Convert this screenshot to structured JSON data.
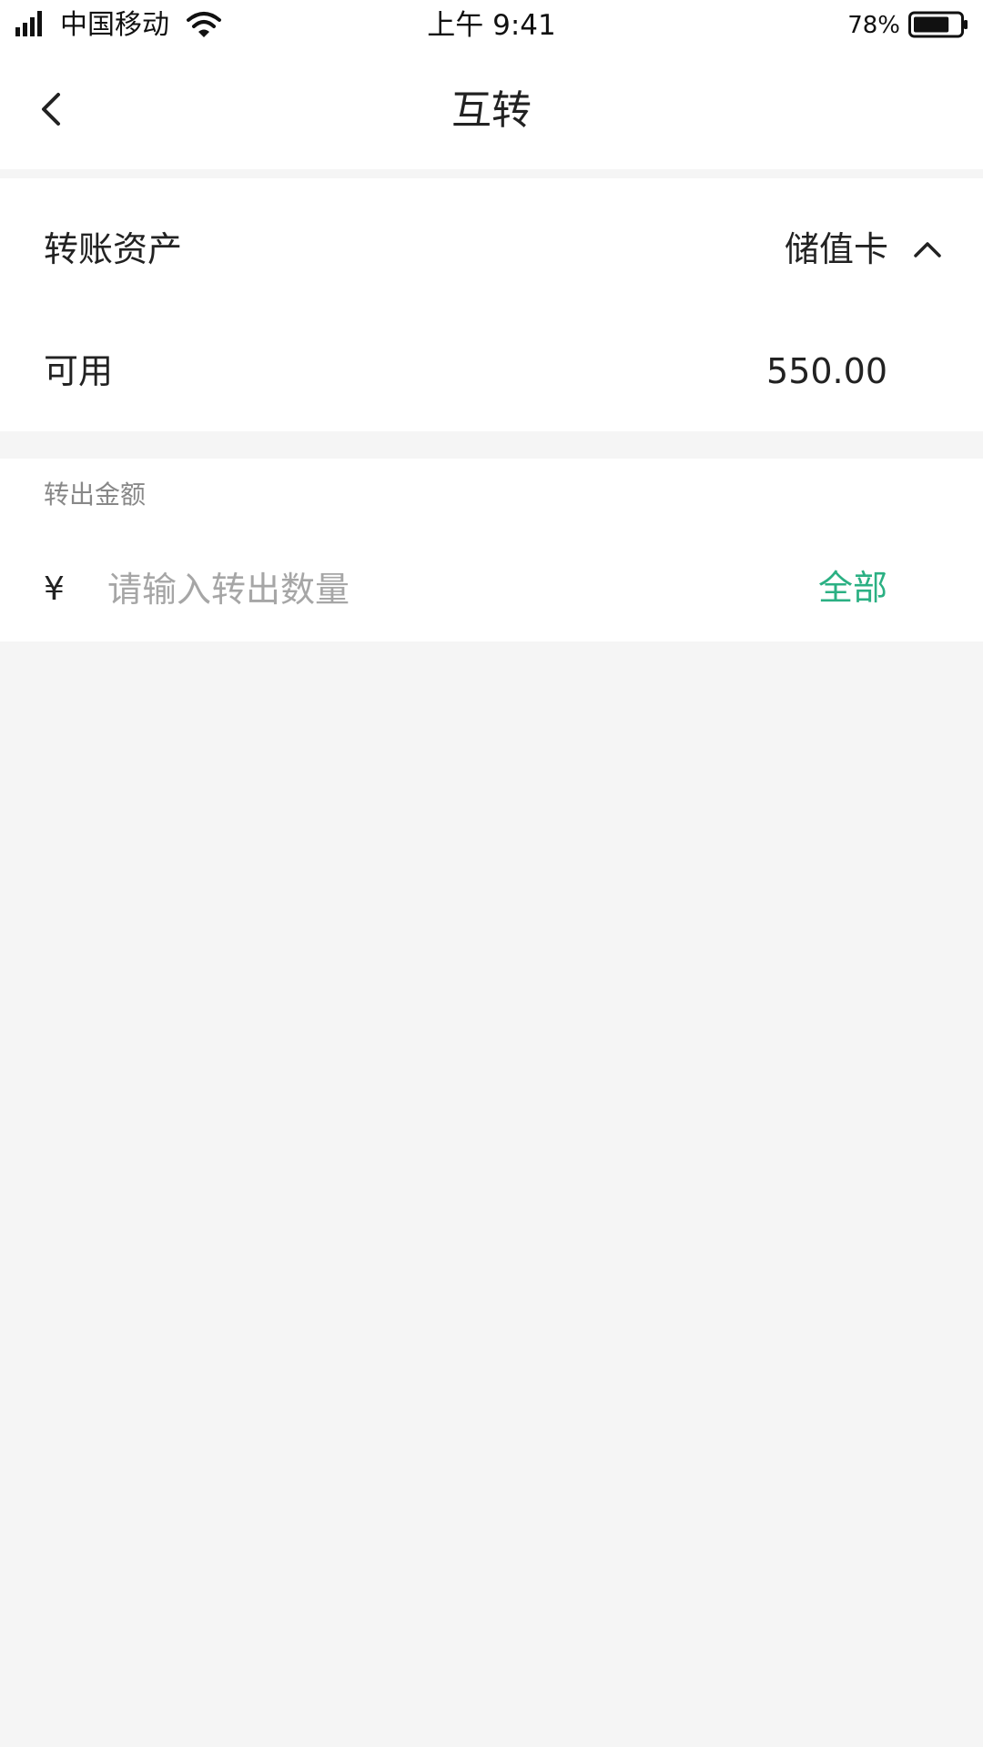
{
  "status_bar": {
    "carrier": "中国移动",
    "time": "上午 9:41",
    "battery_percent": "78%",
    "battery_level": 0.78,
    "icons": [
      "signal-icon",
      "wifi-icon",
      "battery-icon"
    ]
  },
  "nav": {
    "title": "互转",
    "back_icon": "chevron-left-icon"
  },
  "asset": {
    "label": "转账资产",
    "value": "储值卡",
    "toggle_icon": "chevron-up-icon"
  },
  "available": {
    "label": "可用",
    "value": "550.00"
  },
  "amount": {
    "section_label": "转出金额",
    "currency_symbol": "¥",
    "placeholder": "请输入转出数量",
    "all_label": "全部"
  },
  "colors": {
    "accent": "#2bb083",
    "background": "#f5f5f5",
    "surface": "#ffffff",
    "text_primary": "#222222",
    "text_secondary": "#888888",
    "placeholder": "#a6a6a6"
  }
}
